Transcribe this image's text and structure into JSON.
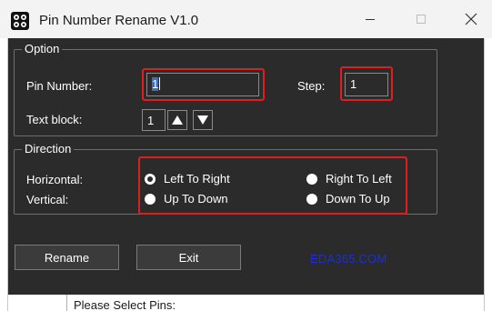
{
  "window": {
    "title": "Pin Number Rename V1.0"
  },
  "option": {
    "legend": "Option",
    "pin_number_label": "Pin Number:",
    "pin_number_value": "1",
    "step_label": "Step:",
    "step_value": "1",
    "text_block_label": "Text block:",
    "text_block_value": "1"
  },
  "direction": {
    "legend": "Direction",
    "horizontal_label": "Horizontal:",
    "vertical_label": "Vertical:",
    "left_to_right": "Left To Right",
    "right_to_left": "Right To Left",
    "up_to_down": "Up To Down",
    "down_to_up": "Down To Up"
  },
  "buttons": {
    "rename": "Rename",
    "exit": "Exit"
  },
  "watermark": "EDA365.COM",
  "status": {
    "message": "Please Select Pins:"
  },
  "icons": {
    "app": "app-grid-icon",
    "minimize": "minimize-icon",
    "maximize": "maximize-icon",
    "close": "close-icon",
    "up": "arrow-up-icon",
    "down": "arrow-down-icon"
  },
  "colors": {
    "highlight": "#e01e1e",
    "watermark": "#1c2fd4",
    "client_bg": "#2b2b2b"
  }
}
